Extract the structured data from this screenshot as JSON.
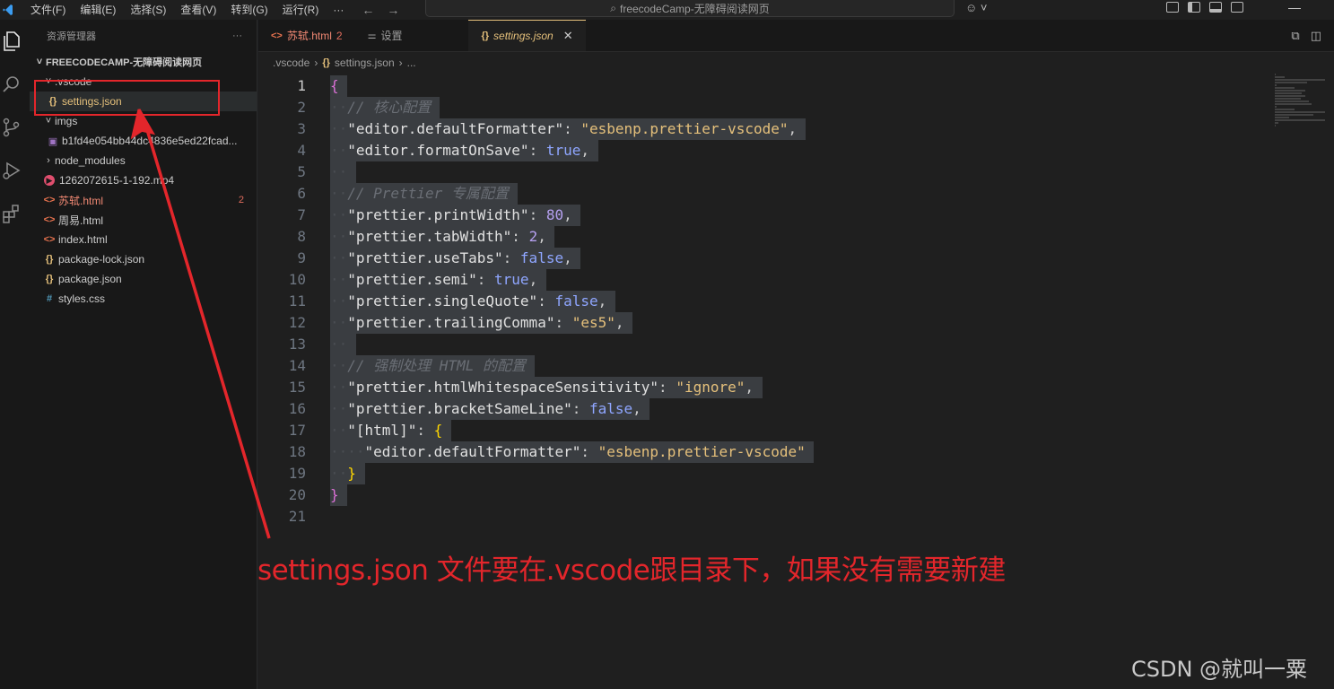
{
  "titlebar": {
    "menu": [
      "文件(F)",
      "编辑(E)",
      "选择(S)",
      "查看(V)",
      "转到(G)",
      "运行(R)",
      "···"
    ],
    "search_text": "freecodeCamp-无障碍阅读网页"
  },
  "sidebar": {
    "header": "资源管理器",
    "folder_name": "FREECODECAMP-无障碍阅读网页",
    "tree": [
      {
        "label": ".vscode",
        "type": "folder-open",
        "indent": 1
      },
      {
        "label": "settings.json",
        "type": "json",
        "indent": 2,
        "selected": true
      },
      {
        "label": "imgs",
        "type": "folder-open",
        "indent": 1
      },
      {
        "label": "b1fd4e054bb44dc4836e5ed22fcad...",
        "type": "image",
        "indent": 2
      },
      {
        "label": "node_modules",
        "type": "folder-closed",
        "indent": 1
      },
      {
        "label": "1262072615-1-192.mp4",
        "type": "mp4",
        "indent": 1
      },
      {
        "label": "苏轼.html",
        "type": "html",
        "indent": 1,
        "error": "2"
      },
      {
        "label": "周易.html",
        "type": "html",
        "indent": 1
      },
      {
        "label": "index.html",
        "type": "html",
        "indent": 1
      },
      {
        "label": "package-lock.json",
        "type": "json",
        "indent": 1
      },
      {
        "label": "package.json",
        "type": "json",
        "indent": 1
      },
      {
        "label": "styles.css",
        "type": "css",
        "indent": 1
      }
    ]
  },
  "tabs": [
    {
      "label": "苏轼.html",
      "icon": "<>",
      "badge": "2",
      "active": false
    },
    {
      "label": "设置",
      "icon": "settings-icon",
      "active": false
    },
    {
      "label": "settings.json",
      "icon": "{}",
      "active": true
    }
  ],
  "breadcrumb": [
    ".vscode",
    "settings.json",
    "..."
  ],
  "code_lines": [
    {
      "n": "1",
      "tokens": [
        [
          "tok-brace",
          "{"
        ]
      ]
    },
    {
      "n": "2",
      "tokens": [
        [
          "ws",
          "··"
        ],
        [
          "tok-comment",
          "// 核心配置"
        ]
      ]
    },
    {
      "n": "3",
      "tokens": [
        [
          "ws",
          "··"
        ],
        [
          "tok-key",
          "\"editor.defaultFormatter\""
        ],
        [
          "tok-punc",
          ": "
        ],
        [
          "tok-str",
          "\"esbenp.prettier-vscode\""
        ],
        [
          "tok-punc",
          ","
        ]
      ]
    },
    {
      "n": "4",
      "tokens": [
        [
          "ws",
          "··"
        ],
        [
          "tok-key",
          "\"editor.formatOnSave\""
        ],
        [
          "tok-punc",
          ": "
        ],
        [
          "tok-bool",
          "true"
        ],
        [
          "tok-punc",
          ","
        ]
      ]
    },
    {
      "n": "5",
      "tokens": [
        [
          "ws",
          "··"
        ]
      ]
    },
    {
      "n": "6",
      "tokens": [
        [
          "ws",
          "··"
        ],
        [
          "tok-comment",
          "// Prettier 专属配置"
        ]
      ]
    },
    {
      "n": "7",
      "tokens": [
        [
          "ws",
          "··"
        ],
        [
          "tok-key",
          "\"prettier.printWidth\""
        ],
        [
          "tok-punc",
          ": "
        ],
        [
          "tok-num",
          "80"
        ],
        [
          "tok-punc",
          ","
        ]
      ]
    },
    {
      "n": "8",
      "tokens": [
        [
          "ws",
          "··"
        ],
        [
          "tok-key",
          "\"prettier.tabWidth\""
        ],
        [
          "tok-punc",
          ": "
        ],
        [
          "tok-num",
          "2"
        ],
        [
          "tok-punc",
          ","
        ]
      ]
    },
    {
      "n": "9",
      "tokens": [
        [
          "ws",
          "··"
        ],
        [
          "tok-key",
          "\"prettier.useTabs\""
        ],
        [
          "tok-punc",
          ": "
        ],
        [
          "tok-bool",
          "false"
        ],
        [
          "tok-punc",
          ","
        ]
      ]
    },
    {
      "n": "10",
      "tokens": [
        [
          "ws",
          "··"
        ],
        [
          "tok-key",
          "\"prettier.semi\""
        ],
        [
          "tok-punc",
          ": "
        ],
        [
          "tok-bool",
          "true"
        ],
        [
          "tok-punc",
          ","
        ]
      ]
    },
    {
      "n": "11",
      "tokens": [
        [
          "ws",
          "··"
        ],
        [
          "tok-key",
          "\"prettier.singleQuote\""
        ],
        [
          "tok-punc",
          ": "
        ],
        [
          "tok-bool",
          "false"
        ],
        [
          "tok-punc",
          ","
        ]
      ]
    },
    {
      "n": "12",
      "tokens": [
        [
          "ws",
          "··"
        ],
        [
          "tok-key",
          "\"prettier.trailingComma\""
        ],
        [
          "tok-punc",
          ": "
        ],
        [
          "tok-str",
          "\"es5\""
        ],
        [
          "tok-punc",
          ","
        ]
      ]
    },
    {
      "n": "13",
      "tokens": [
        [
          "ws",
          "··"
        ]
      ]
    },
    {
      "n": "14",
      "tokens": [
        [
          "ws",
          "··"
        ],
        [
          "tok-comment",
          "// 强制处理 HTML 的配置"
        ]
      ]
    },
    {
      "n": "15",
      "tokens": [
        [
          "ws",
          "··"
        ],
        [
          "tok-key",
          "\"prettier.htmlWhitespaceSensitivity\""
        ],
        [
          "tok-punc",
          ": "
        ],
        [
          "tok-str",
          "\"ignore\""
        ],
        [
          "tok-punc",
          ","
        ]
      ]
    },
    {
      "n": "16",
      "tokens": [
        [
          "ws",
          "··"
        ],
        [
          "tok-key",
          "\"prettier.bracketSameLine\""
        ],
        [
          "tok-punc",
          ": "
        ],
        [
          "tok-bool",
          "false"
        ],
        [
          "tok-punc",
          ","
        ]
      ]
    },
    {
      "n": "17",
      "tokens": [
        [
          "ws",
          "··"
        ],
        [
          "tok-key",
          "\"[html]\""
        ],
        [
          "tok-punc",
          ": "
        ],
        [
          "tok-brace2",
          "{"
        ]
      ]
    },
    {
      "n": "18",
      "tokens": [
        [
          "ws",
          "····"
        ],
        [
          "tok-key",
          "\"editor.defaultFormatter\""
        ],
        [
          "tok-punc",
          ": "
        ],
        [
          "tok-str",
          "\"esbenp.prettier-vscode\""
        ]
      ]
    },
    {
      "n": "19",
      "tokens": [
        [
          "ws",
          "··"
        ],
        [
          "tok-brace2",
          "}"
        ]
      ]
    },
    {
      "n": "20",
      "tokens": [
        [
          "tok-brace",
          "}"
        ]
      ]
    },
    {
      "n": "21",
      "tokens": []
    }
  ],
  "annotation": {
    "text": "settings.json 文件要在.vscode跟目录下，如果没有需要新建",
    "color": "#e3262b"
  },
  "watermark": "CSDN @就叫一粟"
}
